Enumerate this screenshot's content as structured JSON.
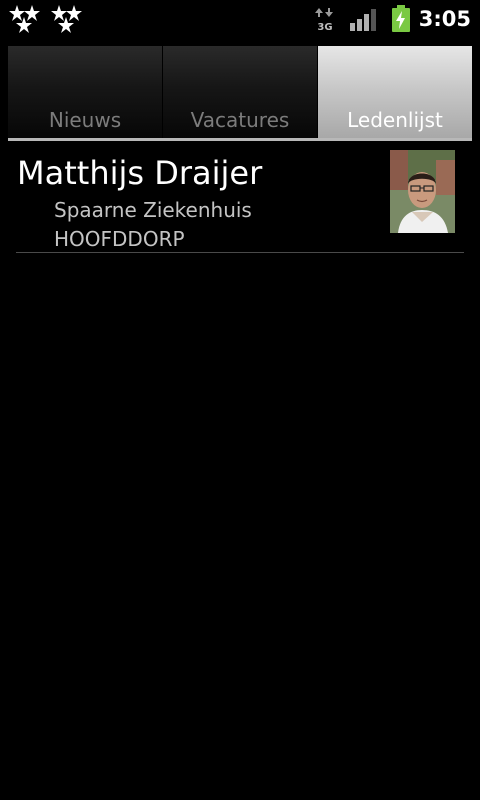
{
  "status_bar": {
    "time": "3:05",
    "network_type": "3G",
    "notification_icons": [
      "stars-notification-icon",
      "stars-notification-icon"
    ],
    "signal_strength_bars": 3,
    "battery_charging": true,
    "colors": {
      "battery": "#7ac943"
    }
  },
  "tabs": [
    {
      "label": "Nieuws",
      "active": false
    },
    {
      "label": "Vacatures",
      "active": false
    },
    {
      "label": "Ledenlijst",
      "active": true
    }
  ],
  "members": [
    {
      "name": "Matthijs Draijer",
      "organization": "Spaarne Ziekenhuis",
      "city": "HOOFDDORP",
      "photo_icon": "person-photo"
    }
  ],
  "colors": {
    "background": "#000000",
    "tab_active": "#c8c8c8",
    "tab_inactive_text": "#7c7c7c",
    "secondary_text": "#c4c4c4"
  }
}
